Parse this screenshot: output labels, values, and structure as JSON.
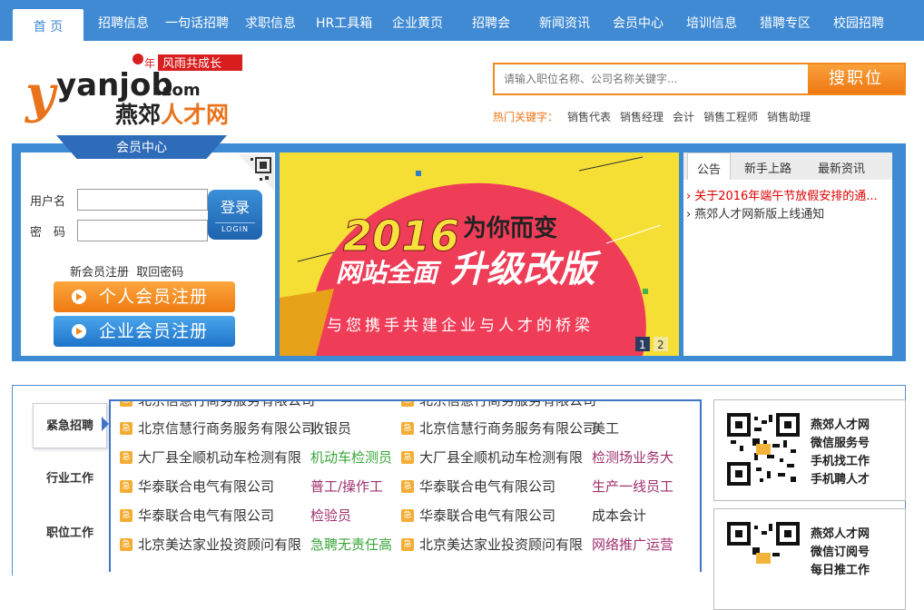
{
  "nav": {
    "home": "首 页",
    "items": [
      "招聘信息",
      "一句话招聘",
      "求职信息",
      "HR工具箱",
      "企业黄页",
      "招聘会",
      "新闻资讯",
      "会员中心",
      "培训信息",
      "猎聘专区",
      "校园招聘"
    ]
  },
  "logo": {
    "slogan": "风雨共成长",
    "year_mark": "年",
    "domain": "yanjob",
    "dotcom": ".com",
    "site_name_1": "燕郊",
    "site_name_2": "人才网"
  },
  "search": {
    "placeholder": "请输入职位名称、公司名称关键字...",
    "button": "搜职位"
  },
  "hot": {
    "label": "热门关键字：",
    "keywords": [
      "销售代表",
      "销售经理",
      "会计",
      "销售工程师",
      "销售助理"
    ]
  },
  "member": {
    "tab": "会员中心",
    "username_label": "用户名",
    "password_label": "密　码",
    "login": "登录",
    "login_en": "LOGIN",
    "register_link": "新会员注册",
    "recover_link": "取回密码",
    "personal_register": "个人会员注册",
    "company_register": "企业会员注册"
  },
  "banner": {
    "line1": "2016",
    "line2": "为你而变",
    "line3": "网站全面",
    "line4": "升级改版",
    "line5": "与您携手共建企业与人才的桥梁",
    "pages": [
      "1",
      "2"
    ]
  },
  "news": {
    "tabs": [
      "公告",
      "新手上路",
      "最新资讯"
    ],
    "items": [
      "关于2016年端午节放假安排的通...",
      "燕郊人才网新版上线通知"
    ]
  },
  "side_tabs": [
    "紧急招聘",
    "行业工作",
    "职位工作"
  ],
  "urgent_icon": "急",
  "jobs": [
    {
      "co1": "北京信慧行商务服务有限公司",
      "job1": "收银员",
      "co2": "北京信慧行商务服务有限公司",
      "job2": "美工",
      "c1": "#333333",
      "c2": "#333333"
    },
    {
      "co1": "大厂县全顺机动车检测有限",
      "job1": "机动车检测员",
      "co2": "大厂县全顺机动车检测有限",
      "job2": "检测场业务大",
      "c1": "#3aa63a",
      "c2": "#a0306e"
    },
    {
      "co1": "华泰联合电气有限公司",
      "job1": "普工/操作工",
      "co2": "华泰联合电气有限公司",
      "job2": "生产一线员工",
      "c1": "#a0306e",
      "c2": "#a0306e"
    },
    {
      "co1": "华泰联合电气有限公司",
      "job1": "检验员",
      "co2": "华泰联合电气有限公司",
      "job2": "成本会计",
      "c1": "#a0306e",
      "c2": "#333333"
    },
    {
      "co1": "北京美达家业投资顾问有限",
      "job1": "急聘无责任高",
      "co2": "北京美达家业投资顾问有限",
      "job2": "网络推广运营",
      "c1": "#3aa63a",
      "c2": "#a0306e"
    }
  ],
  "qr_panels": [
    {
      "lines": [
        "燕郊人才网",
        "微信服务号",
        "手机找工作",
        "手机聘人才"
      ]
    },
    {
      "lines": [
        "燕郊人才网",
        "微信订阅号",
        "每日推工作"
      ]
    }
  ]
}
